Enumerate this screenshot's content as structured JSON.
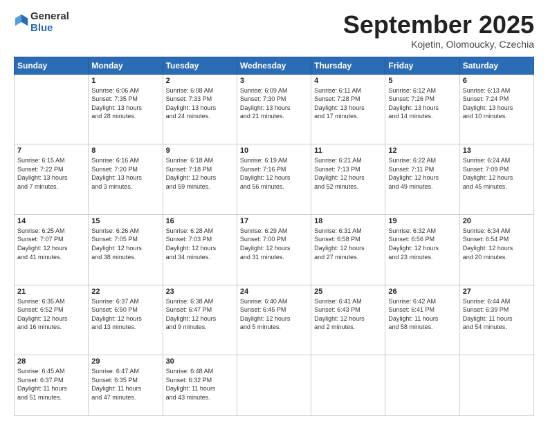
{
  "header": {
    "logo_general": "General",
    "logo_blue": "Blue",
    "month_title": "September 2025",
    "location": "Kojetin, Olomoucky, Czechia"
  },
  "days_of_week": [
    "Sunday",
    "Monday",
    "Tuesday",
    "Wednesday",
    "Thursday",
    "Friday",
    "Saturday"
  ],
  "weeks": [
    [
      {
        "day": "",
        "info": ""
      },
      {
        "day": "1",
        "info": "Sunrise: 6:06 AM\nSunset: 7:35 PM\nDaylight: 13 hours\nand 28 minutes."
      },
      {
        "day": "2",
        "info": "Sunrise: 6:08 AM\nSunset: 7:33 PM\nDaylight: 13 hours\nand 24 minutes."
      },
      {
        "day": "3",
        "info": "Sunrise: 6:09 AM\nSunset: 7:30 PM\nDaylight: 13 hours\nand 21 minutes."
      },
      {
        "day": "4",
        "info": "Sunrise: 6:11 AM\nSunset: 7:28 PM\nDaylight: 13 hours\nand 17 minutes."
      },
      {
        "day": "5",
        "info": "Sunrise: 6:12 AM\nSunset: 7:26 PM\nDaylight: 13 hours\nand 14 minutes."
      },
      {
        "day": "6",
        "info": "Sunrise: 6:13 AM\nSunset: 7:24 PM\nDaylight: 13 hours\nand 10 minutes."
      }
    ],
    [
      {
        "day": "7",
        "info": "Sunrise: 6:15 AM\nSunset: 7:22 PM\nDaylight: 13 hours\nand 7 minutes."
      },
      {
        "day": "8",
        "info": "Sunrise: 6:16 AM\nSunset: 7:20 PM\nDaylight: 13 hours\nand 3 minutes."
      },
      {
        "day": "9",
        "info": "Sunrise: 6:18 AM\nSunset: 7:18 PM\nDaylight: 12 hours\nand 59 minutes."
      },
      {
        "day": "10",
        "info": "Sunrise: 6:19 AM\nSunset: 7:16 PM\nDaylight: 12 hours\nand 56 minutes."
      },
      {
        "day": "11",
        "info": "Sunrise: 6:21 AM\nSunset: 7:13 PM\nDaylight: 12 hours\nand 52 minutes."
      },
      {
        "day": "12",
        "info": "Sunrise: 6:22 AM\nSunset: 7:11 PM\nDaylight: 12 hours\nand 49 minutes."
      },
      {
        "day": "13",
        "info": "Sunrise: 6:24 AM\nSunset: 7:09 PM\nDaylight: 12 hours\nand 45 minutes."
      }
    ],
    [
      {
        "day": "14",
        "info": "Sunrise: 6:25 AM\nSunset: 7:07 PM\nDaylight: 12 hours\nand 41 minutes."
      },
      {
        "day": "15",
        "info": "Sunrise: 6:26 AM\nSunset: 7:05 PM\nDaylight: 12 hours\nand 38 minutes."
      },
      {
        "day": "16",
        "info": "Sunrise: 6:28 AM\nSunset: 7:03 PM\nDaylight: 12 hours\nand 34 minutes."
      },
      {
        "day": "17",
        "info": "Sunrise: 6:29 AM\nSunset: 7:00 PM\nDaylight: 12 hours\nand 31 minutes."
      },
      {
        "day": "18",
        "info": "Sunrise: 6:31 AM\nSunset: 6:58 PM\nDaylight: 12 hours\nand 27 minutes."
      },
      {
        "day": "19",
        "info": "Sunrise: 6:32 AM\nSunset: 6:56 PM\nDaylight: 12 hours\nand 23 minutes."
      },
      {
        "day": "20",
        "info": "Sunrise: 6:34 AM\nSunset: 6:54 PM\nDaylight: 12 hours\nand 20 minutes."
      }
    ],
    [
      {
        "day": "21",
        "info": "Sunrise: 6:35 AM\nSunset: 6:52 PM\nDaylight: 12 hours\nand 16 minutes."
      },
      {
        "day": "22",
        "info": "Sunrise: 6:37 AM\nSunset: 6:50 PM\nDaylight: 12 hours\nand 13 minutes."
      },
      {
        "day": "23",
        "info": "Sunrise: 6:38 AM\nSunset: 6:47 PM\nDaylight: 12 hours\nand 9 minutes."
      },
      {
        "day": "24",
        "info": "Sunrise: 6:40 AM\nSunset: 6:45 PM\nDaylight: 12 hours\nand 5 minutes."
      },
      {
        "day": "25",
        "info": "Sunrise: 6:41 AM\nSunset: 6:43 PM\nDaylight: 12 hours\nand 2 minutes."
      },
      {
        "day": "26",
        "info": "Sunrise: 6:42 AM\nSunset: 6:41 PM\nDaylight: 11 hours\nand 58 minutes."
      },
      {
        "day": "27",
        "info": "Sunrise: 6:44 AM\nSunset: 6:39 PM\nDaylight: 11 hours\nand 54 minutes."
      }
    ],
    [
      {
        "day": "28",
        "info": "Sunrise: 6:45 AM\nSunset: 6:37 PM\nDaylight: 11 hours\nand 51 minutes."
      },
      {
        "day": "29",
        "info": "Sunrise: 6:47 AM\nSunset: 6:35 PM\nDaylight: 11 hours\nand 47 minutes."
      },
      {
        "day": "30",
        "info": "Sunrise: 6:48 AM\nSunset: 6:32 PM\nDaylight: 11 hours\nand 43 minutes."
      },
      {
        "day": "",
        "info": ""
      },
      {
        "day": "",
        "info": ""
      },
      {
        "day": "",
        "info": ""
      },
      {
        "day": "",
        "info": ""
      }
    ]
  ]
}
